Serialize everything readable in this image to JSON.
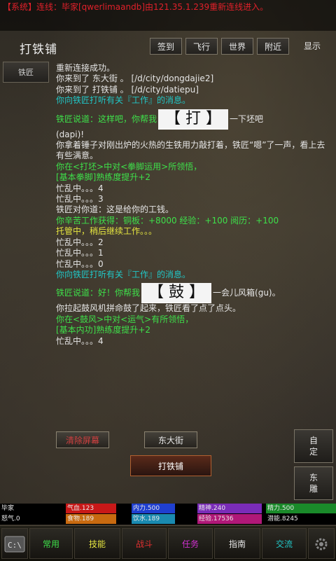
{
  "system_message": "【系统】连线：毕家[qwerlimaandb]由121.35.1.239重新连线进入。",
  "room": {
    "title": "打铁铺"
  },
  "header_buttons": [
    "签到",
    "飞行",
    "世界",
    "附近",
    "显示"
  ],
  "npc": {
    "label": "铁匠"
  },
  "log": {
    "l1": "重新连接成功。",
    "l2": "你来到了 东大街 。 [/d/city/dongdajie2]",
    "l3": "你来到了 打铁铺 。 [/d/city/datiepu]",
    "l4": "你向铁匠打听有关『工作』的消息。",
    "l5_prefix": "铁匠说道：这样吧，你帮我",
    "l5_word": "【 打 】",
    "l5_suffix": "一下坯吧",
    "l6": "(dapi)!",
    "l7": "你拿着锤子对刚出炉的火热的生铁用力敲打着，铁匠“嗯”了一声，看上去有些满意。",
    "l8": "你在<打坯>中对<拳脚运用>所领悟，",
    "l9": "[基本拳脚]熟练度提升+2",
    "l10": "忙乱中。。。4",
    "l11": "忙乱中。。。3",
    "l12": "铁匠对你道：这是给你的工钱。",
    "l13": "你辛苦工作获得：铜板：+8000 经验：+100 阅历：+100",
    "l14": "托管中，稍后继续工作。。。",
    "l15": "忙乱中。。。2",
    "l16": "忙乱中。。。1",
    "l17": "忙乱中。。。0",
    "l18": "你向铁匠打听有关『工作』的消息。",
    "l19_prefix": "铁匠说道：好！你帮我",
    "l19_word": "【 鼓 】",
    "l19_suffix": "一会儿风箱(gu)。",
    "l20": "你拉起鼓风机拼命鼓了起来，铁匠看了点了点头。",
    "l21": "你在<鼓风>中对<运气>有所领悟，",
    "l22": "[基本内功]熟练度提升+2",
    "l23": "忙乱中。。。4"
  },
  "exits": {
    "left": "清除屏幕",
    "right": "东大街",
    "current": "打铁铺"
  },
  "side_buttons": {
    "auto": "自定",
    "rank": "东雕"
  },
  "stats": {
    "name": "毕家",
    "qixue": "气血.123",
    "neili": "内力.500",
    "jingshen": "精神.240",
    "jingli": "精力.500",
    "nuqi": "怒气.0",
    "shiwu": "食物.189",
    "yinshui": "饮水.189",
    "jingyan": "经验.17536",
    "qianneng": "潜能.8245"
  },
  "stat_colors": {
    "qixue": "#c81818",
    "neili": "#1f3fd0",
    "jingshen": "#7a2cb8",
    "jingli": "#1a8a2a",
    "shiwu": "#c86a10",
    "yinshui": "#1a8ab0",
    "jingyan": "#b01878"
  },
  "bottom_nav": {
    "console": "console-icon",
    "items": [
      "常用",
      "技能",
      "战斗",
      "任务",
      "指南",
      "交流"
    ],
    "settings": "gear-icon"
  }
}
